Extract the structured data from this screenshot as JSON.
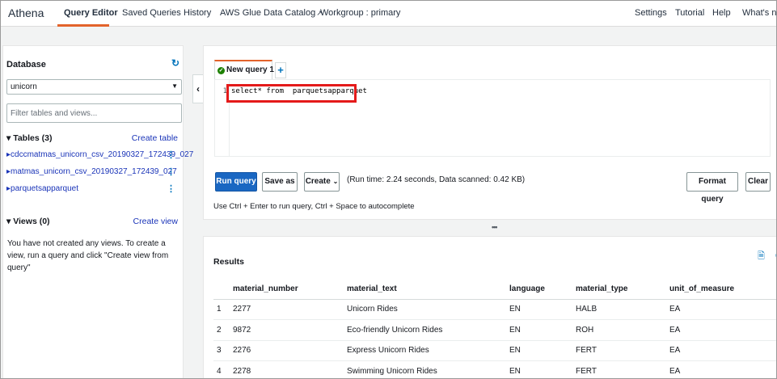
{
  "nav": {
    "brand": "Athena",
    "items": [
      "Query Editor",
      "Saved Queries",
      "History",
      "AWS Glue Data Catalog",
      "Workgroup : primary"
    ],
    "right_items": [
      "Settings",
      "Tutorial",
      "Help",
      "What's new"
    ],
    "active": "Query Editor"
  },
  "sidebar": {
    "database_label": "Database",
    "database_value": "unicorn",
    "filter_placeholder": "Filter tables and views...",
    "tables_title": "Tables (3)",
    "create_table": "Create table",
    "tables": [
      "cdccmatmas_unicorn_csv_20190327_172439_027",
      "matmas_unicorn_csv_20190327_172439_027",
      "parquetsapparquet"
    ],
    "views_title": "Views (0)",
    "create_view": "Create view",
    "views_message": "You have not created any views. To create a view, run a query and click \"Create view from query\""
  },
  "editor": {
    "tab_label": "New query 1",
    "add_tab": "+",
    "line_number": "1",
    "query": "select* from  parquetsapparquet",
    "buttons": {
      "run": "Run query",
      "save_as": "Save as",
      "create": "Create",
      "format": "Format query",
      "clear": "Clear"
    },
    "run_info": "(Run time: 2.24 seconds, Data scanned: 0.42 KB)",
    "hint": "Use Ctrl + Enter to run query, Ctrl + Space to autocomplete"
  },
  "results": {
    "title": "Results",
    "columns": [
      "",
      "material_number",
      "material_text",
      "language",
      "material_type",
      "unit_of_measure"
    ],
    "rows": [
      [
        "1",
        "2277",
        "Unicorn Rides",
        "EN",
        "HALB",
        "EA"
      ],
      [
        "2",
        "9872",
        "Eco-friendly Unicorn Rides",
        "EN",
        "ROH",
        "EA"
      ],
      [
        "3",
        "2276",
        "Express Unicorn Rides",
        "EN",
        "FERT",
        "EA"
      ],
      [
        "4",
        "2278",
        "Swimming Unicorn Rides",
        "EN",
        "FERT",
        "EA"
      ]
    ]
  },
  "colors": {
    "accent": "#e3632b",
    "primary_button": "#1a67c2",
    "link": "#1a34b8",
    "highlight": "#e41a1a"
  }
}
